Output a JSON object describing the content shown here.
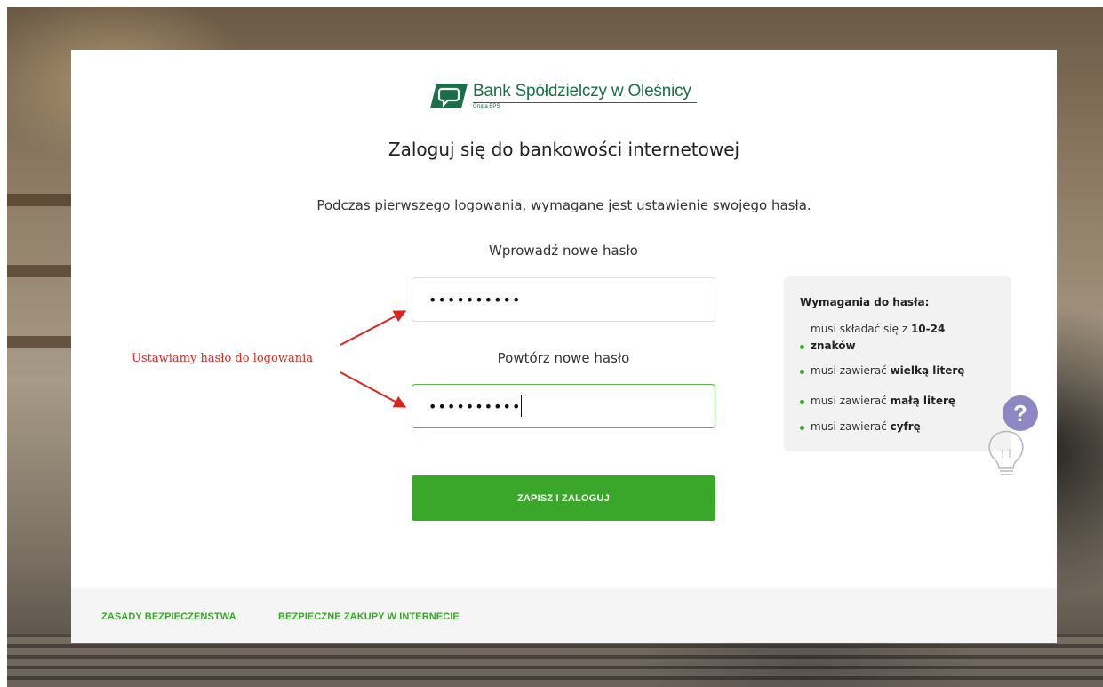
{
  "brand": {
    "name": "Bank Spółdzielczy w Oleśnicy",
    "group": "Grupa BPS",
    "color": "#1a6f46"
  },
  "login": {
    "title": "Zaloguj się do bankowości internetowej",
    "intro": "Podczas pierwszego logowania, wymagane jest ustawienie swojego hasła.",
    "new_password_label": "Wprowadź nowe hasło",
    "new_password_value": "••••••••••",
    "repeat_password_label": "Powtórz nowe hasło",
    "repeat_password_value": "••••••••••",
    "submit_label": "ZAPISZ I ZALOGUJ",
    "accent_color": "#3aa62a"
  },
  "requirements": {
    "title": "Wymagania do hasła:",
    "items": [
      {
        "prefix": "musi składać się z ",
        "strong": "10-24 znaków"
      },
      {
        "prefix": "musi zawierać ",
        "strong": "wielką literę"
      },
      {
        "prefix": "musi zawierać ",
        "strong": "małą literę"
      },
      {
        "prefix": "musi zawierać ",
        "strong": "cyfrę"
      }
    ],
    "help_icon": "lightbulb-question-icon"
  },
  "annotation": {
    "text": "Ustawiamy hasło do logowania",
    "color": "#d9261c"
  },
  "footer": {
    "links": [
      "ZASADY BEZPIECZEŃSTWA",
      "BEZPIECZNE ZAKUPY W INTERNECIE"
    ]
  }
}
